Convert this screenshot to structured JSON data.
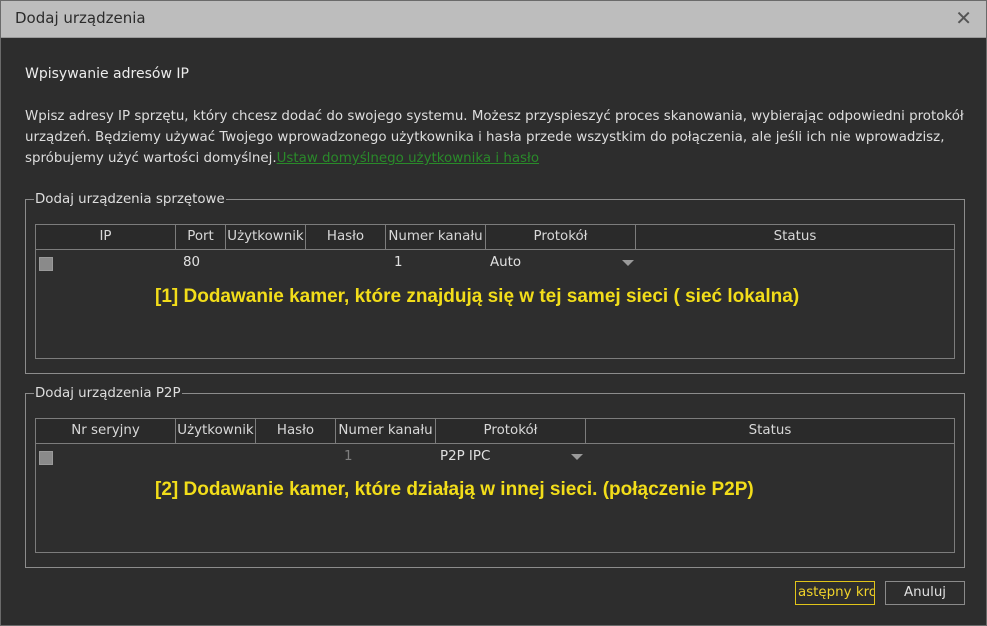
{
  "dialog": {
    "title": "Dodaj urządzenia",
    "close_glyph": "✕",
    "section_title": "Wpisywanie adresów IP",
    "description": "Wpisz adresy IP sprzętu, który chcesz dodać do swojego systemu. Możesz przyspieszyć proces skanowania, wybierając odpowiedni protokół urządzeń. Będziemy używać Twojego wprowadzonego użytkownika i hasła przede wszystkim do połączenia, ale jeśli ich nie wprowadzisz, spróbujemy użyć wartości domyślnej.",
    "default_link": "Ustaw domyślnego użytkownika i hasło"
  },
  "hardware": {
    "legend": "Dodaj urządzenia sprzętowe",
    "columns": [
      "IP",
      "Port",
      "Użytkownik",
      "Hasło",
      "Numer kanału",
      "Protokół",
      "Status"
    ],
    "row": {
      "port": "80",
      "channel": "1",
      "protocol": "Auto"
    },
    "annotation": "[1] Dodawanie kamer, które znajdują się w tej samej sieci ( sieć lokalna)"
  },
  "p2p": {
    "legend": "Dodaj urządzenia P2P",
    "columns": [
      "Nr seryjny",
      "Użytkownik",
      "Hasło",
      "Numer kanału",
      "Protokół",
      "Status"
    ],
    "row": {
      "channel": "1",
      "protocol": "P2P IPC"
    },
    "annotation": "[2] Dodawanie kamer, które działają w innej sieci. (połączenie P2P)"
  },
  "buttons": {
    "next": "astępny kro",
    "cancel": "Anuluj"
  },
  "colors": {
    "accent": "#f2dd1a",
    "link": "#2a8a2a",
    "background": "#2d2d2d"
  }
}
